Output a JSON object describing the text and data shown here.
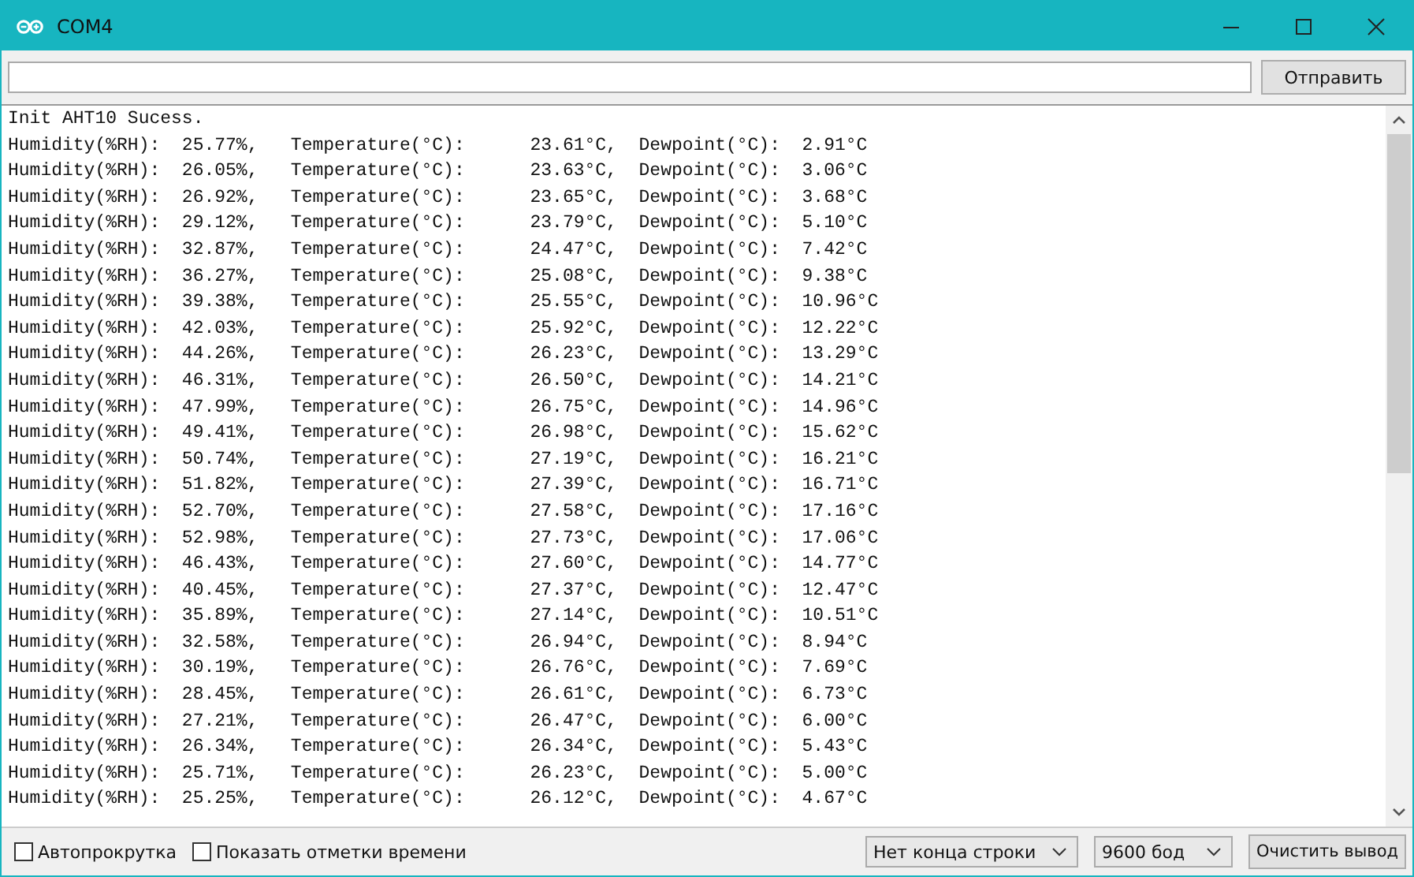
{
  "window": {
    "title": "COM4"
  },
  "send_button": "Отправить",
  "output_lines": [
    "Init AHT10 Sucess.",
    "Humidity(%RH):  25.77%,   Temperature(°C):      23.61°C,  Dewpoint(°C):  2.91°C",
    "Humidity(%RH):  26.05%,   Temperature(°C):      23.63°C,  Dewpoint(°C):  3.06°C",
    "Humidity(%RH):  26.92%,   Temperature(°C):      23.65°C,  Dewpoint(°C):  3.68°C",
    "Humidity(%RH):  29.12%,   Temperature(°C):      23.79°C,  Dewpoint(°C):  5.10°C",
    "Humidity(%RH):  32.87%,   Temperature(°C):      24.47°C,  Dewpoint(°C):  7.42°C",
    "Humidity(%RH):  36.27%,   Temperature(°C):      25.08°C,  Dewpoint(°C):  9.38°C",
    "Humidity(%RH):  39.38%,   Temperature(°C):      25.55°C,  Dewpoint(°C):  10.96°C",
    "Humidity(%RH):  42.03%,   Temperature(°C):      25.92°C,  Dewpoint(°C):  12.22°C",
    "Humidity(%RH):  44.26%,   Temperature(°C):      26.23°C,  Dewpoint(°C):  13.29°C",
    "Humidity(%RH):  46.31%,   Temperature(°C):      26.50°C,  Dewpoint(°C):  14.21°C",
    "Humidity(%RH):  47.99%,   Temperature(°C):      26.75°C,  Dewpoint(°C):  14.96°C",
    "Humidity(%RH):  49.41%,   Temperature(°C):      26.98°C,  Dewpoint(°C):  15.62°C",
    "Humidity(%RH):  50.74%,   Temperature(°C):      27.19°C,  Dewpoint(°C):  16.21°C",
    "Humidity(%RH):  51.82%,   Temperature(°C):      27.39°C,  Dewpoint(°C):  16.71°C",
    "Humidity(%RH):  52.70%,   Temperature(°C):      27.58°C,  Dewpoint(°C):  17.16°C",
    "Humidity(%RH):  52.98%,   Temperature(°C):      27.73°C,  Dewpoint(°C):  17.06°C",
    "Humidity(%RH):  46.43%,   Temperature(°C):      27.60°C,  Dewpoint(°C):  14.77°C",
    "Humidity(%RH):  40.45%,   Temperature(°C):      27.37°C,  Dewpoint(°C):  12.47°C",
    "Humidity(%RH):  35.89%,   Temperature(°C):      27.14°C,  Dewpoint(°C):  10.51°C",
    "Humidity(%RH):  32.58%,   Temperature(°C):      26.94°C,  Dewpoint(°C):  8.94°C",
    "Humidity(%RH):  30.19%,   Temperature(°C):      26.76°C,  Dewpoint(°C):  7.69°C",
    "Humidity(%RH):  28.45%,   Temperature(°C):      26.61°C,  Dewpoint(°C):  6.73°C",
    "Humidity(%RH):  27.21%,   Temperature(°C):      26.47°C,  Dewpoint(°C):  6.00°C",
    "Humidity(%RH):  26.34%,   Temperature(°C):      26.34°C,  Dewpoint(°C):  5.43°C",
    "Humidity(%RH):  25.71%,   Temperature(°C):      26.23°C,  Dewpoint(°C):  5.00°C",
    "Humidity(%RH):  25.25%,   Temperature(°C):      26.12°C,  Dewpoint(°C):  4.67°C"
  ],
  "options": [
    {
      "label": "Автопрокрутка",
      "checked": false
    },
    {
      "label": "Показать отметки времени",
      "checked": false
    }
  ],
  "line_ending_select": "Нет конца строки",
  "baud_select": "9600 бод",
  "clear_button": "Очистить вывод"
}
